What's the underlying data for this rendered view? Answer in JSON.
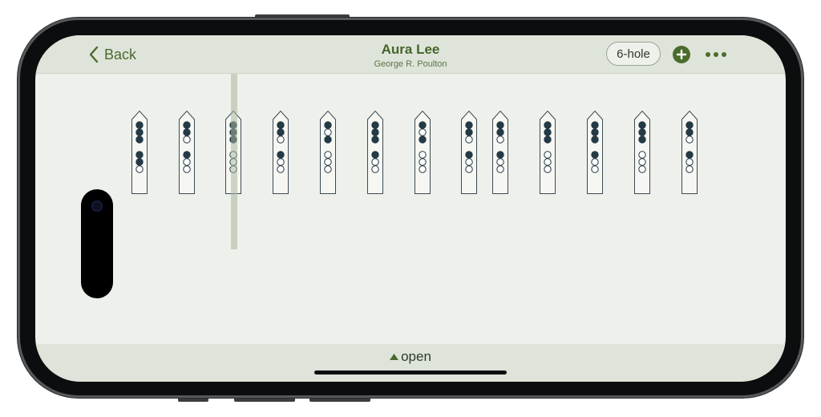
{
  "header": {
    "back_label": "Back",
    "title": "Aura Lee",
    "composer": "George R. Poulton",
    "hole_mode": "6-hole"
  },
  "footer": {
    "toggle_label": "open"
  },
  "colors": {
    "accent": "#4b6b2e",
    "filled_hole": "#243a45",
    "header_bg": "#dfe4da",
    "content_bg": "#eef0eb"
  },
  "icons": {
    "back": "chevron-left-icon",
    "add": "plus-circle-icon",
    "more": "ellipsis-icon",
    "open": "triangle-up-icon"
  },
  "playhead_note_index": 2,
  "fingerings": [
    [
      1,
      1,
      1,
      1,
      1,
      0
    ],
    [
      1,
      1,
      0,
      1,
      0,
      0
    ],
    [
      1,
      1,
      1,
      0,
      0,
      0
    ],
    [
      1,
      1,
      0,
      1,
      0,
      0
    ],
    [
      1,
      0,
      1,
      0,
      0,
      0
    ],
    [
      1,
      1,
      1,
      1,
      0,
      0
    ],
    [
      1,
      0,
      1,
      0,
      0,
      0
    ],
    [
      1,
      1,
      0,
      1,
      0,
      0
    ],
    [
      1,
      1,
      0,
      1,
      0,
      0
    ],
    [
      1,
      1,
      1,
      0,
      0,
      0
    ],
    [
      1,
      1,
      1,
      1,
      0,
      0
    ],
    [
      1,
      1,
      1,
      0,
      0,
      0
    ],
    [
      1,
      1,
      0,
      1,
      0,
      0
    ]
  ]
}
